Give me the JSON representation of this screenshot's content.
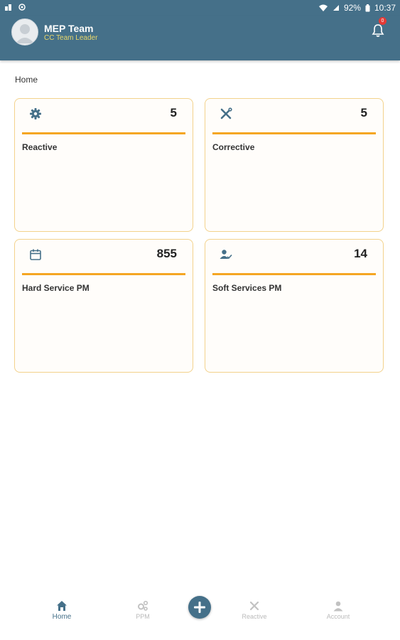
{
  "status_bar": {
    "battery_percent": "92%",
    "time": "10:37"
  },
  "header": {
    "team_name": "MEP Team",
    "team_role": "CC Team Leader",
    "notification_count": "0"
  },
  "breadcrumb": "Home",
  "cards": [
    {
      "label": "Reactive",
      "count": "5",
      "icon": "gear-icon"
    },
    {
      "label": "Corrective",
      "count": "5",
      "icon": "tools-icon"
    },
    {
      "label": "Hard Service PM",
      "count": "855",
      "icon": "calendar-icon"
    },
    {
      "label": "Soft Services PM",
      "count": "14",
      "icon": "user-check-icon"
    }
  ],
  "bottom_nav": {
    "items": [
      {
        "label": "Home",
        "icon": "home-icon",
        "active": true
      },
      {
        "label": "PPM",
        "icon": "gears-icon",
        "active": false
      },
      {
        "label": "Reactive",
        "icon": "tools-icon",
        "active": false
      },
      {
        "label": "Account",
        "icon": "person-icon",
        "active": false
      }
    ],
    "fab_icon": "plus-icon"
  },
  "colors": {
    "primary": "#457089",
    "accent": "#f5a623",
    "card_border": "#f3d28c",
    "role_text": "#e8d66a",
    "badge": "#e53935"
  }
}
